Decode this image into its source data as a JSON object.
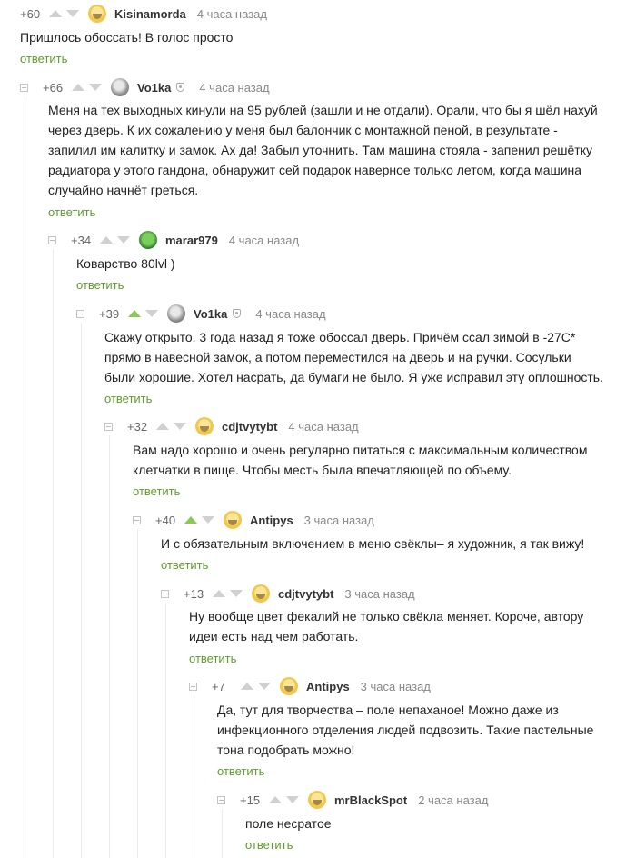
{
  "reply_label": "ответить",
  "accent_green": "#5f9c2c",
  "comments": [
    {
      "rating": "+60",
      "username": "Kisinamorda",
      "time": "4 часа назад",
      "avatar_icon": "avatar-gold-icon",
      "upvoted": false,
      "text": [
        "Пришлось обоссать! В голос просто"
      ]
    },
    {
      "rating": "+66",
      "username": "Vo1ka",
      "time": "4 часа назад",
      "avatar_icon": "avatar-gray-icon",
      "upvoted": false,
      "verified": true,
      "text": [
        "Меня на тех выходных кинули на 95 рублей (зашли и не отдали). Орали, что бы я шёл нахуй",
        "через дверь. К их сожалению у меня был балончик с монтажной пеной, в результате -",
        "запилил им калитку и замок. Ах да! Забыл уточнить. Там машина стояла - запенил решётку",
        "радиатора у этого гандона, обнаружит сей подарок наверное только летом, когда машина",
        "случайно начнёт греться."
      ]
    },
    {
      "rating": "+34",
      "username": "marar979",
      "time": "4 часа назад",
      "avatar_icon": "avatar-green-icon",
      "upvoted": false,
      "text": [
        "Коварство 80lvl )"
      ]
    },
    {
      "rating": "+39",
      "username": "Vo1ka",
      "time": "4 часа назад",
      "avatar_icon": "avatar-gray-icon",
      "upvoted": true,
      "verified": true,
      "text": [
        "Скажу открыто. 3 года назад я тоже обоссал дверь. Причём ссал зимой в -27С*",
        "прямо в навесной замок, а потом переместился на дверь и на ручки. Сосульки",
        "были хорошие. Хотел насрать, да бумаги не  было. Я уже исправил эту оплошность."
      ]
    },
    {
      "rating": "+32",
      "username": "cdjtvytybt",
      "time": "4 часа назад",
      "avatar_icon": "avatar-gold-icon",
      "upvoted": false,
      "text": [
        "Вам надо хорошо и очень регулярно питаться с максимальным количеством",
        "клетчатки в пище. Чтобы месть была впечатляющей по объему."
      ]
    },
    {
      "rating": "+40",
      "username": "Antipys",
      "time": "3 часа назад",
      "avatar_icon": "avatar-gold-icon",
      "upvoted": true,
      "text": [
        "И с обязательным включением в меню свёклы– я художник, я так вижу!"
      ]
    },
    {
      "rating": "+13",
      "username": "cdjtvytybt",
      "time": "3 часа назад",
      "avatar_icon": "avatar-gold-icon",
      "upvoted": false,
      "text": [
        "Ну вообще цвет фекалий не только свёкла меняет. Короче, автору",
        "идеи есть над чем работать."
      ]
    },
    {
      "rating": "+7",
      "username": "Antipys",
      "time": "3 часа назад",
      "avatar_icon": "avatar-gold-icon",
      "upvoted": false,
      "text": [
        "Да, тут для творчества – поле непаханое! Можно даже из",
        "инфекционного отделения людей подвозить. Такие пастельные",
        "тона подобрать можно!"
      ]
    },
    {
      "rating": "+15",
      "username": "mrBlackSpot",
      "time": "2 часа назад",
      "avatar_icon": "avatar-gold-icon",
      "upvoted": false,
      "text": [
        "поле несратое"
      ]
    }
  ]
}
